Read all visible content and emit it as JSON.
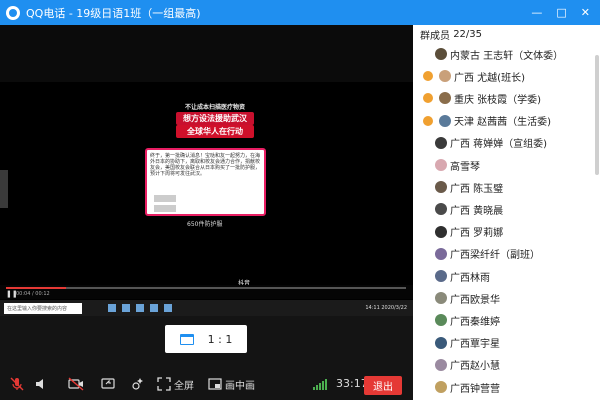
{
  "window": {
    "title": "QQ电话 - 19级日语1班（一组最高)",
    "controls": [
      "—",
      "□",
      "✕"
    ]
  },
  "video": {
    "banner_small": "不让成本扫描医疗物资",
    "banner_line1": "想方设法援助武汉",
    "banner_line2": "全球华人在行动",
    "card_text": "终于，第一批确认消息！宝哒和友一起努力，在海外日本的协助下，离取和校友会通力合作，捐献校友会，美国校友会联合从日本购买了一批防护服，预计下周将可发往武汉。",
    "caption": "650件防护服",
    "douyin_label": "抖音",
    "douyin_id": "抖音号: Zuluotte",
    "play_time": "00:04 / 00:12",
    "taskbar_search": "在这里输入你要搜索的内容",
    "taskbar_clock": "14:11 2020/3/22"
  },
  "ratio": {
    "label": "1 : 1"
  },
  "toolbar": {
    "fullscreen_label": "全屏",
    "pip_label": "画中画",
    "timer": "33:17",
    "exit_label": "退出"
  },
  "members": {
    "header_label": "群成员",
    "count": "22/35",
    "list": [
      {
        "name": "内蒙古 王志轩（文体委）",
        "avatar": "#5b4e3a",
        "mic": false
      },
      {
        "name": "广西 尤越(班长)",
        "avatar": "#c9a07a",
        "mic": true
      },
      {
        "name": "重庆 张枝霞（学委)",
        "avatar": "#8a6d4b",
        "mic": true
      },
      {
        "name": "天津  赵茜茜（生活委)",
        "avatar": "#5a7a9a",
        "mic": true
      },
      {
        "name": "广西 蒋婵婵（宣组委)",
        "avatar": "#3a3a3a",
        "mic": false
      },
      {
        "name": "高雪琴",
        "avatar": "#d8a8b0",
        "mic": false
      },
      {
        "name": "广西   陈玉璧",
        "avatar": "#6a5a4a",
        "mic": false
      },
      {
        "name": "广西 黄晓晨",
        "avatar": "#4a4a4a",
        "mic": false
      },
      {
        "name": "广西 罗莉娜",
        "avatar": "#2f2f2f",
        "mic": false
      },
      {
        "name": "广西梁纤纤（副班）",
        "avatar": "#7a6a9a",
        "mic": false
      },
      {
        "name": "广西林雨",
        "avatar": "#5a6a8a",
        "mic": false
      },
      {
        "name": "广西欧景华",
        "avatar": "#8a8a7a",
        "mic": false
      },
      {
        "name": "广西秦维婷",
        "avatar": "#5a8a5a",
        "mic": false
      },
      {
        "name": "广西覃宇星",
        "avatar": "#3a5a7a",
        "mic": false
      },
      {
        "name": "广西赵小慧",
        "avatar": "#9a8aa0",
        "mic": false
      },
      {
        "name": "广西钟营营",
        "avatar": "#c0a060",
        "mic": false
      }
    ]
  },
  "colors": {
    "titlebar": "#1f8ff0",
    "exit": "#e53935",
    "signal": "#4caf50",
    "mic_active": "#f0a030"
  },
  "icons": {
    "mic": "mic-muted-icon",
    "speaker": "speaker-icon",
    "camera": "camera-off-icon",
    "share": "screen-share-icon",
    "effects": "effects-icon",
    "fullscreen": "fullscreen-icon",
    "pip": "picture-in-picture-icon"
  }
}
